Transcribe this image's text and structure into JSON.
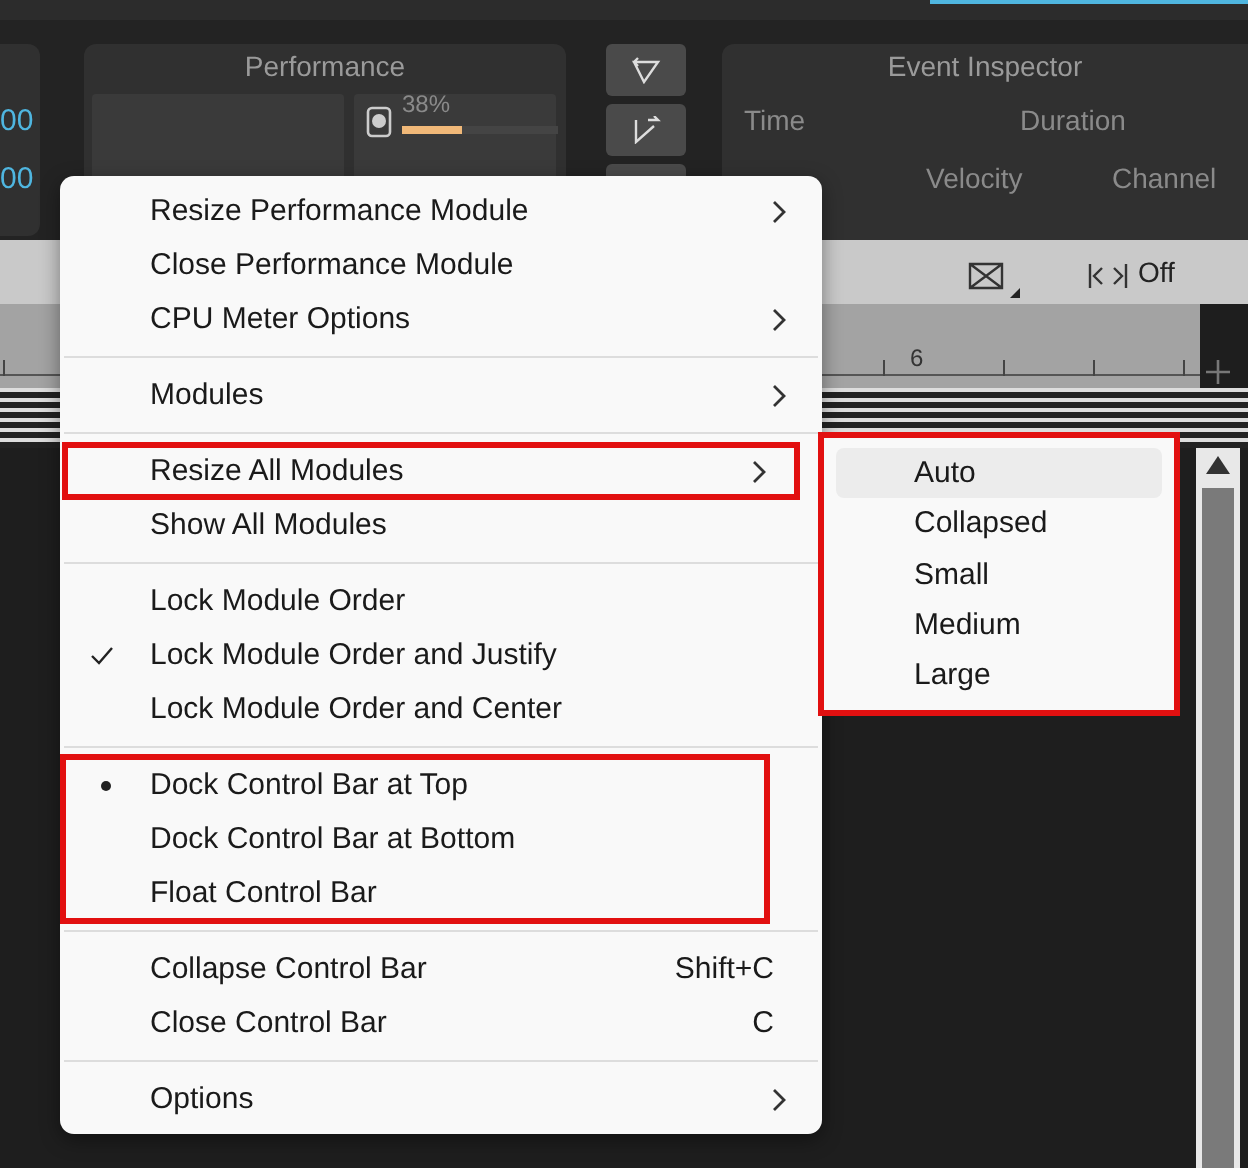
{
  "left_values": [
    "00",
    "00"
  ],
  "performance": {
    "title": "Performance",
    "cpu_reading": "38%",
    "level": 0.38
  },
  "event_inspector": {
    "title": "Event Inspector",
    "labels": [
      "Time",
      "Duration",
      "Velocity",
      "Channel"
    ]
  },
  "toolbar": {
    "snap_label": "Off"
  },
  "ruler": {
    "marker": "6"
  },
  "context_menu": {
    "sections": [
      {
        "items": [
          {
            "label": "Resize Performance Module",
            "submenu": true,
            "checked": false,
            "highlighted": false
          },
          {
            "label": "Close Performance Module",
            "submenu": false,
            "checked": false,
            "highlighted": false
          },
          {
            "label": "CPU Meter Options",
            "submenu": true,
            "checked": false,
            "highlighted": false
          }
        ],
        "highlighted": false
      },
      {
        "items": [
          {
            "label": "Modules",
            "submenu": true,
            "checked": false,
            "highlighted": false
          }
        ],
        "highlighted": false
      },
      {
        "items": [
          {
            "label": "Resize All Modules",
            "submenu": true,
            "checked": false,
            "highlighted": true
          },
          {
            "label": "Show All Modules",
            "submenu": false,
            "checked": false,
            "highlighted": false
          }
        ],
        "highlighted": false
      },
      {
        "items": [
          {
            "label": "Lock Module Order",
            "submenu": false,
            "checked": false,
            "highlighted": false
          },
          {
            "label": "Lock Module Order and Justify",
            "submenu": false,
            "checked": true,
            "highlighted": false
          },
          {
            "label": "Lock Module Order and Center",
            "submenu": false,
            "checked": false,
            "highlighted": false
          }
        ],
        "highlighted": false
      },
      {
        "items": [
          {
            "label": "Dock Control Bar at Top",
            "submenu": false,
            "selected": true,
            "highlighted": false
          },
          {
            "label": "Dock Control Bar at Bottom",
            "submenu": false,
            "selected": false,
            "highlighted": false
          },
          {
            "label": "Float Control Bar",
            "submenu": false,
            "selected": false,
            "highlighted": false
          }
        ],
        "highlighted": true
      },
      {
        "items": [
          {
            "label": "Collapse Control Bar",
            "shortcut": "Shift+C",
            "submenu": false,
            "checked": false,
            "highlighted": false
          },
          {
            "label": "Close Control Bar",
            "shortcut": "C",
            "submenu": false,
            "checked": false,
            "highlighted": false
          }
        ],
        "highlighted": false
      },
      {
        "items": [
          {
            "label": "Options",
            "submenu": true,
            "checked": false,
            "highlighted": false
          }
        ],
        "highlighted": false
      }
    ]
  },
  "submenu": {
    "highlighted": true,
    "items": [
      {
        "label": "Auto",
        "selected": true
      },
      {
        "label": "Collapsed",
        "selected": false
      },
      {
        "label": "Small",
        "selected": false
      },
      {
        "label": "Medium",
        "selected": false
      },
      {
        "label": "Large",
        "selected": false
      }
    ]
  }
}
